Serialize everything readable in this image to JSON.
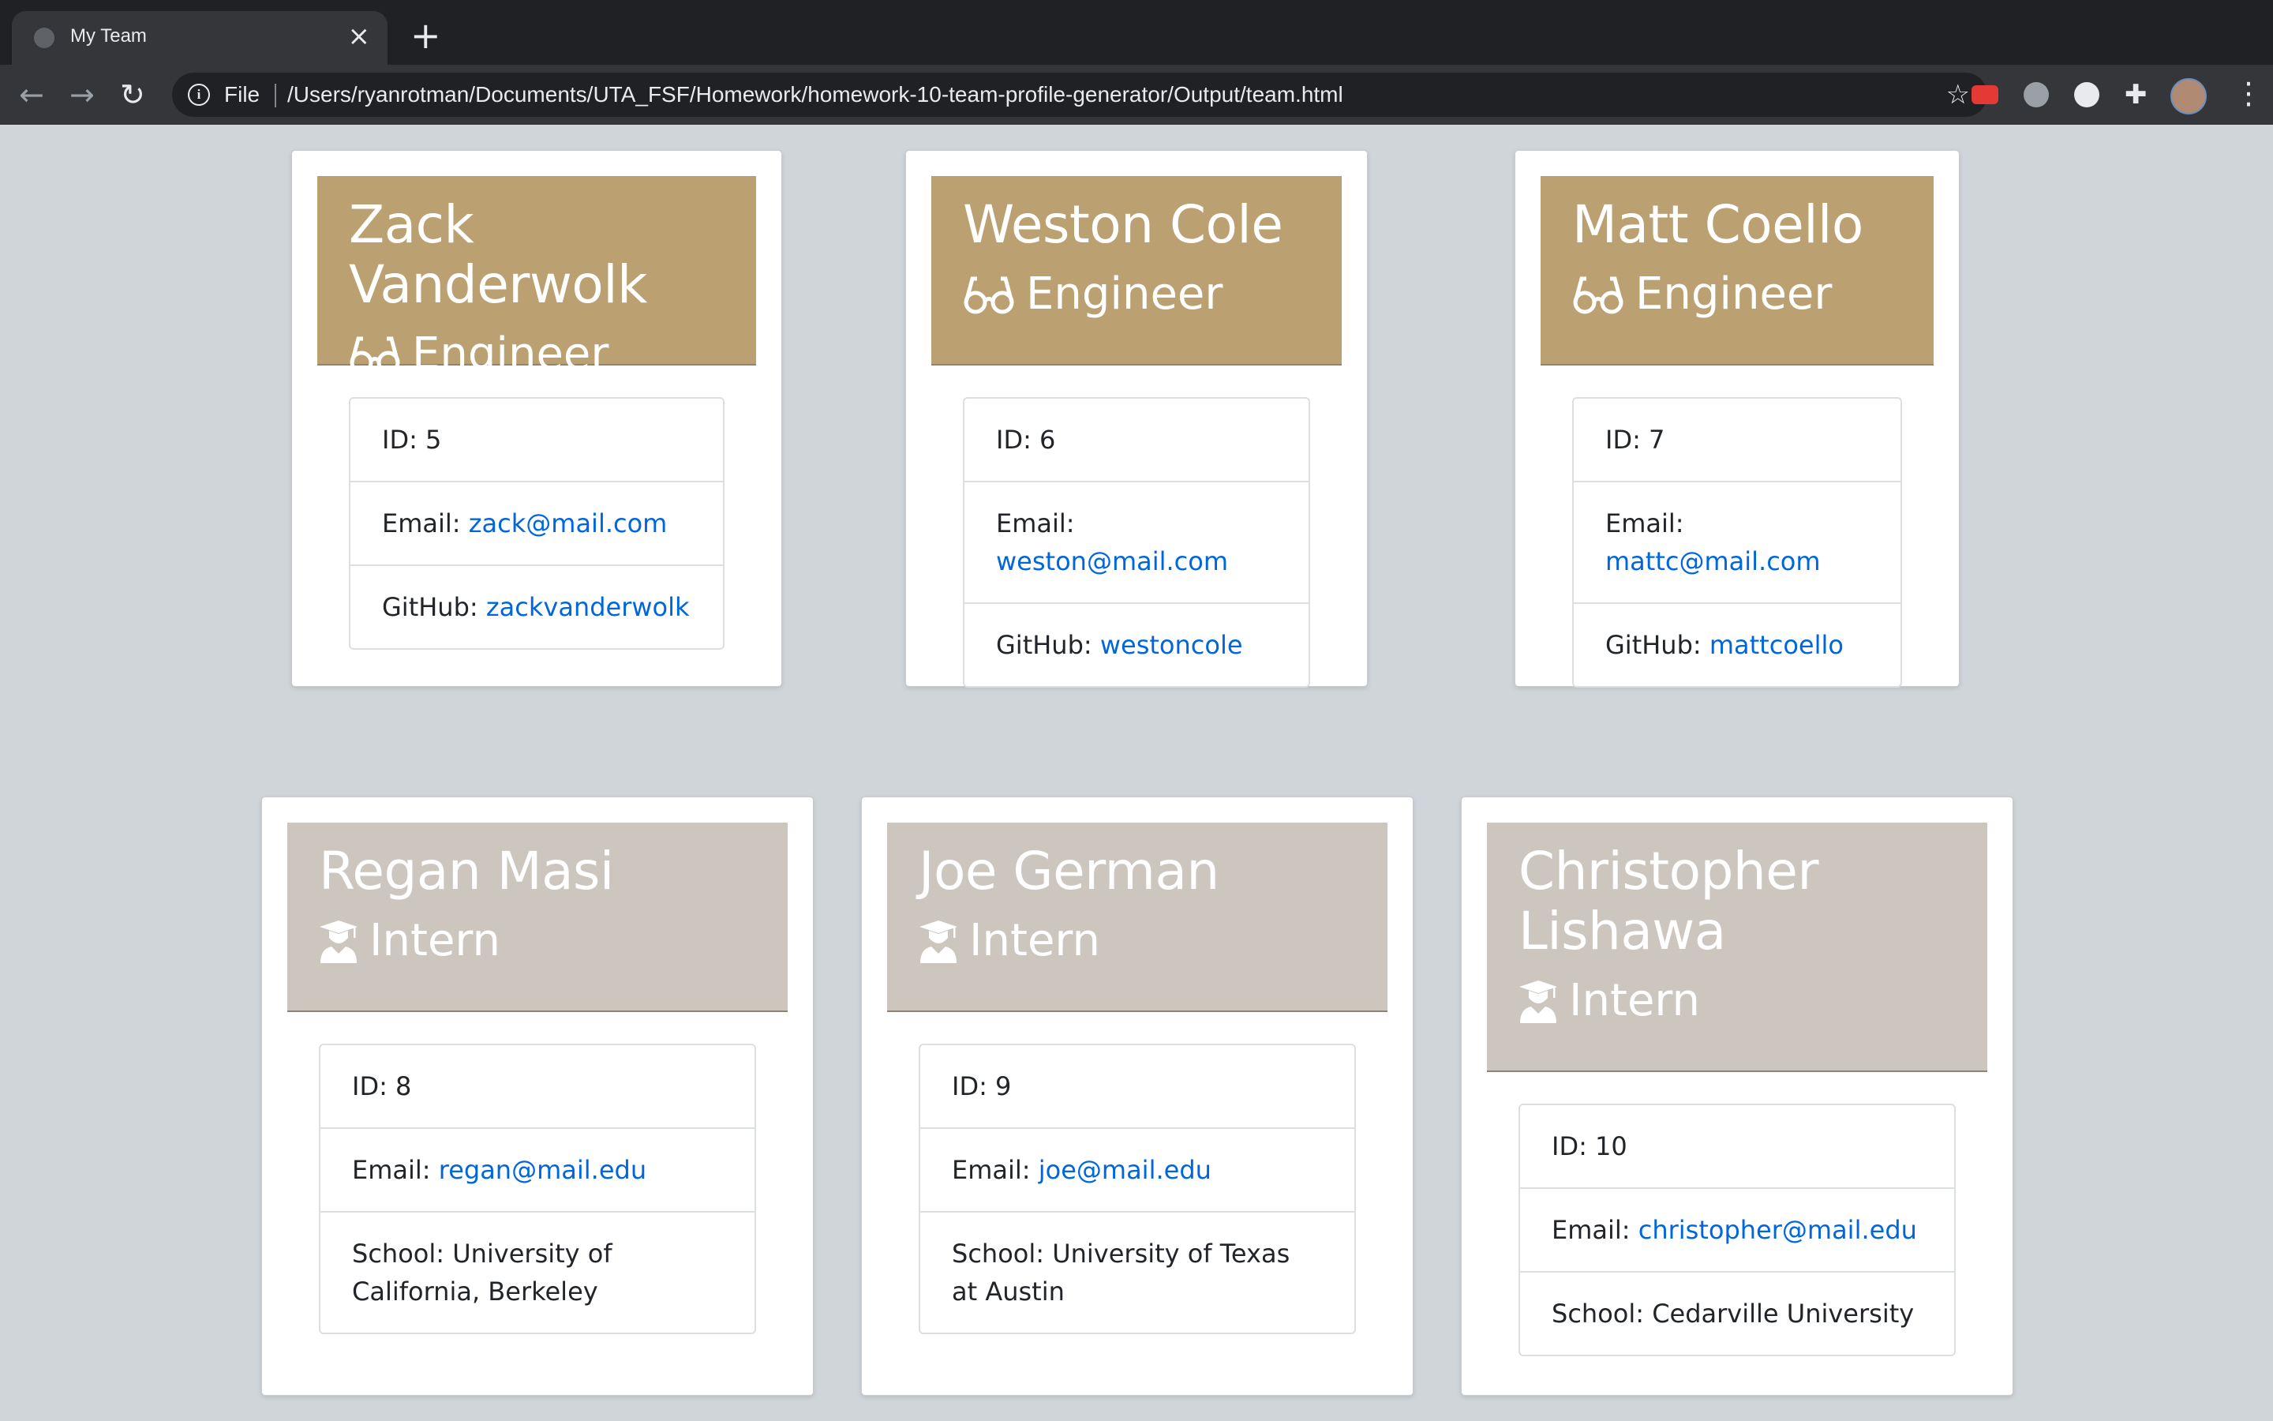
{
  "browser": {
    "tab_title": "My Team",
    "file_label": "File",
    "url": "/Users/ryanrotman/Documents/UTA_FSF/Homework/homework-10-team-profile-generator/Output/team.html"
  },
  "labels": {
    "id": "ID: ",
    "email": "Email: ",
    "github": "GitHub: ",
    "school": "School: "
  },
  "colors": {
    "engineer_header": "#bba071",
    "intern_header": "#cdc6bf",
    "link": "#0066dd",
    "page_background": "#d0d5da"
  },
  "engineers": [
    {
      "name": "Zack Vanderwolk",
      "role": "Engineer",
      "icon": "glasses-icon",
      "id": "5",
      "email": "zack@mail.com",
      "github": "zackvanderwolk"
    },
    {
      "name": "Weston Cole",
      "role": "Engineer",
      "icon": "glasses-icon",
      "id": "6",
      "email": "weston@mail.com",
      "github": "westoncole"
    },
    {
      "name": "Matt Coello",
      "role": "Engineer",
      "icon": "glasses-icon",
      "id": "7",
      "email": "mattc@mail.com",
      "github": "mattcoello"
    }
  ],
  "interns": [
    {
      "name": "Regan Masi",
      "role": "Intern",
      "icon": "graduate-icon",
      "id": "8",
      "email": "regan@mail.edu",
      "school": "University of California, Berkeley"
    },
    {
      "name": "Joe German",
      "role": "Intern",
      "icon": "graduate-icon",
      "id": "9",
      "email": "joe@mail.edu",
      "school": "University of Texas at Austin"
    },
    {
      "name": "Christopher Lishawa",
      "role": "Intern",
      "icon": "graduate-icon",
      "id": "10",
      "email": "christopher@mail.edu",
      "school": "Cedarville University"
    }
  ]
}
